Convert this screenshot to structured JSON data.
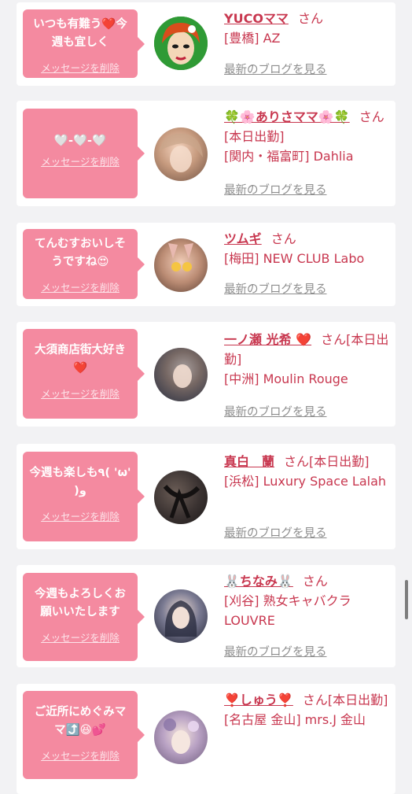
{
  "theme": {
    "bubble": "#f48aa0",
    "name_text": "#c8374f",
    "blog_link": "#8e8e8e",
    "background": "#f2f2f4"
  },
  "delete_label": "メッセージを削除",
  "blog_label": "最新のブログを見る",
  "cards": [
    {
      "message": "いつも有難う❤️今週も宜しく",
      "name": "YUCOママ",
      "honorific": "さん",
      "status": "",
      "shop": "[豊橋] AZ",
      "avatar_icon": "cartoon-face-avatar"
    },
    {
      "message": "🤍-🤍-🤍",
      "name": "🍀🌸ありさママ🌸🍀",
      "honorific": "さん",
      "status": "[本日出勤]",
      "shop": "[関内・福富町] Dahlia",
      "avatar_icon": "photo-avatar"
    },
    {
      "message": "てんむすおいしそうですね😍",
      "name": "ツムギ",
      "honorific": "さん",
      "status": "",
      "shop": "[梅田] NEW CLUB Labo",
      "avatar_icon": "photo-avatar"
    },
    {
      "message": "大須商店街大好き❤️",
      "name": "一ノ瀬 光希 ❤️",
      "honorific": "さん",
      "status": "[本日出勤]",
      "shop": "[中洲] Moulin Rouge",
      "avatar_icon": "photo-avatar"
    },
    {
      "message": "今週も楽しも٩( 'ω' )و",
      "name": "真白　蘭",
      "honorific": "さん",
      "status": "[本日出勤]",
      "shop": "[浜松] Luxury Space Lalah",
      "avatar_icon": "photo-avatar"
    },
    {
      "message": "今週もよろしくお願いいたします",
      "name": "🐰ちなみ🐰",
      "honorific": "さん",
      "status": "",
      "shop": "[刈谷] 熟女キャバクラ LOUVRE",
      "avatar_icon": "photo-avatar"
    },
    {
      "message": "ご近所にめぐみママ⤴️😆💕",
      "name": "❣️しゅう❣️",
      "honorific": "さん",
      "status": "[本日出勤]",
      "shop": "[名古屋 金山] mrs.J 金山",
      "avatar_icon": "photo-avatar"
    }
  ]
}
